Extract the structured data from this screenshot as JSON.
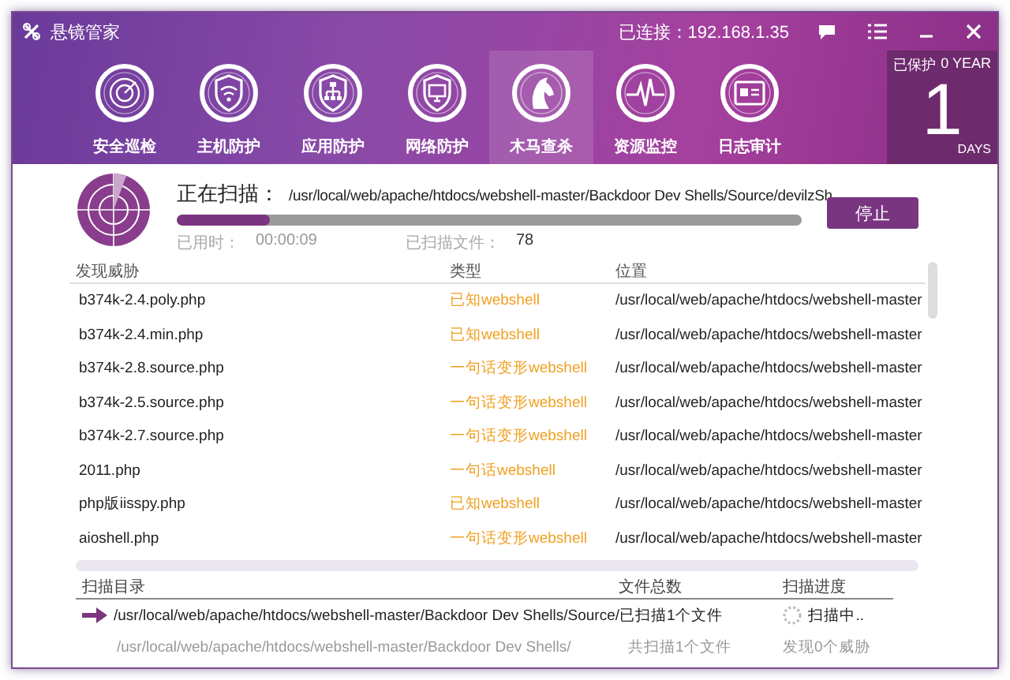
{
  "window": {
    "title": "悬镜管家",
    "connection": "已连接：192.168.1.35"
  },
  "nav": [
    {
      "label": "安全巡检",
      "kind": "radar",
      "selected": false
    },
    {
      "label": "主机防护",
      "kind": "shield-wifi",
      "selected": false
    },
    {
      "label": "应用防护",
      "kind": "shield-network",
      "selected": false
    },
    {
      "label": "网络防护",
      "kind": "shield-monitor",
      "selected": false
    },
    {
      "label": "木马查杀",
      "kind": "horse",
      "selected": true
    },
    {
      "label": "资源监控",
      "kind": "pulse",
      "selected": false
    },
    {
      "label": "日志审计",
      "kind": "log",
      "selected": false
    }
  ],
  "protection": {
    "label": "已保护",
    "years": "0 YEAR",
    "days": "1",
    "days_label": "DAYS"
  },
  "scan": {
    "label": "正在扫描：",
    "path": "/usr/local/web/apache/htdocs/webshell-master/Backdoor Dev Shells/Source/devilzSh",
    "level": 0.15,
    "elapsed_label": "已用时：",
    "elapsed": "00:00:09",
    "files_label": "已扫描文件：",
    "files": "78",
    "stop_button": "停止"
  },
  "threats": {
    "columns": [
      "发现威胁",
      "类型",
      "位置"
    ],
    "rows": [
      {
        "name": "b374k-2.4.poly.php",
        "type": "已知webshell",
        "location": "/usr/local/web/apache/htdocs/webshell-master"
      },
      {
        "name": "b374k-2.4.min.php",
        "type": "已知webshell",
        "location": "/usr/local/web/apache/htdocs/webshell-master"
      },
      {
        "name": "b374k-2.8.source.php",
        "type": "一句话变形webshell",
        "location": "/usr/local/web/apache/htdocs/webshell-master"
      },
      {
        "name": "b374k-2.5.source.php",
        "type": "一句话变形webshell",
        "location": "/usr/local/web/apache/htdocs/webshell-master"
      },
      {
        "name": "b374k-2.7.source.php",
        "type": "一句话变形webshell",
        "location": "/usr/local/web/apache/htdocs/webshell-master"
      },
      {
        "name": "2011.php",
        "type": "一句话webshell",
        "location": "/usr/local/web/apache/htdocs/webshell-master"
      },
      {
        "name": "php版iisspy.php",
        "type": "已知webshell",
        "location": "/usr/local/web/apache/htdocs/webshell-master"
      },
      {
        "name": "aioshell.php",
        "type": "一句话变形webshell",
        "location": "/usr/local/web/apache/htdocs/webshell-master"
      }
    ]
  },
  "directories": {
    "columns": [
      "扫描目录",
      "文件总数",
      "扫描进度"
    ],
    "rows": [
      {
        "path": "/usr/local/web/apache/htdocs/webshell-master/Backdoor Dev Shells/Source/",
        "count": "已扫描1个文件",
        "progress": "扫描中..",
        "active": true
      },
      {
        "path": "/usr/local/web/apache/htdocs/webshell-master/Backdoor Dev Shells/",
        "count": "共扫描1个文件",
        "progress": "发现0个威胁",
        "active": false
      }
    ]
  }
}
